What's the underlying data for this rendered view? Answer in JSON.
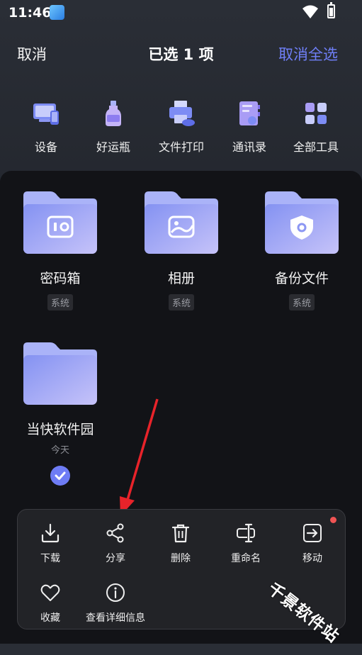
{
  "status_bar": {
    "time": "11:46",
    "icons": [
      "app-badge-icon",
      "wifi-icon",
      "battery-charging-icon"
    ]
  },
  "header": {
    "cancel": "取消",
    "title": "已选 1 项",
    "deselect_all": "取消全选",
    "accent_color": "#6f7ff7"
  },
  "tools": [
    {
      "label": "设备",
      "icon": "device-icon"
    },
    {
      "label": "好运瓶",
      "icon": "bottle-icon"
    },
    {
      "label": "文件打印",
      "icon": "printer-icon"
    },
    {
      "label": "通讯录",
      "icon": "contacts-icon"
    },
    {
      "label": "全部工具",
      "icon": "all-tools-icon"
    }
  ],
  "folders": [
    {
      "name": "密码箱",
      "badge": "系统",
      "icon": "safe-icon"
    },
    {
      "name": "相册",
      "badge": "系统",
      "icon": "photo-icon"
    },
    {
      "name": "备份文件",
      "badge": "系统",
      "icon": "shield-icon"
    },
    {
      "name": "当快软件园",
      "date": "今天",
      "selected": true
    }
  ],
  "actions": [
    {
      "label": "下载",
      "icon": "download-icon"
    },
    {
      "label": "分享",
      "icon": "share-icon"
    },
    {
      "label": "删除",
      "icon": "trash-icon"
    },
    {
      "label": "重命名",
      "icon": "rename-icon"
    },
    {
      "label": "移动",
      "icon": "move-icon",
      "has_dot": true
    },
    {
      "label": "收藏",
      "icon": "heart-icon"
    },
    {
      "label": "查看详细信息",
      "icon": "info-icon"
    }
  ],
  "watermark": "千景软件站"
}
